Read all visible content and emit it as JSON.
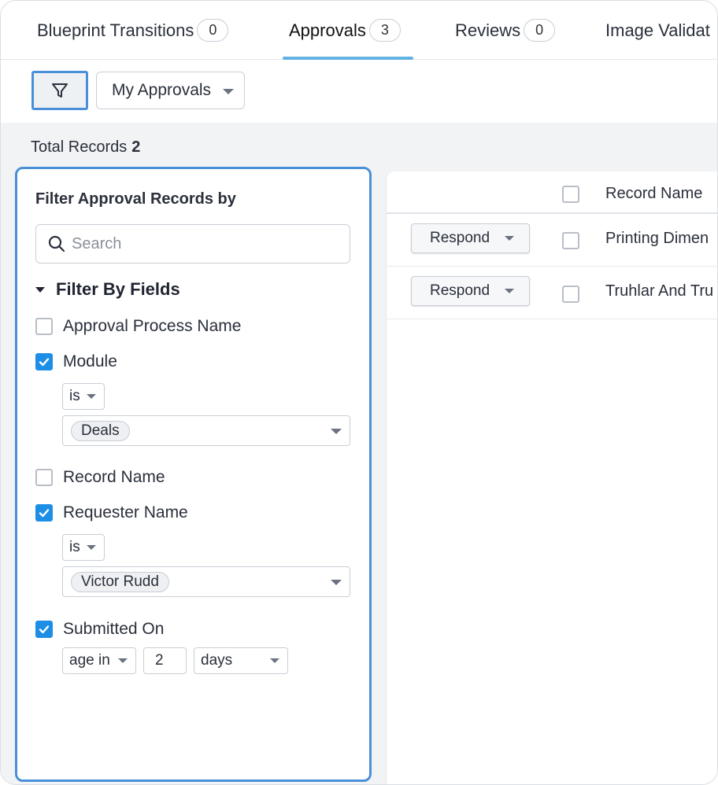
{
  "tabs": [
    {
      "label": "Blueprint Transitions",
      "count": "0"
    },
    {
      "label": "Approvals",
      "count": "3"
    },
    {
      "label": "Reviews",
      "count": "0"
    },
    {
      "label": "Image Validat",
      "count": ""
    }
  ],
  "toolbar": {
    "view_label": "My Approvals"
  },
  "summary": {
    "total_label": "Total Records",
    "total_value": "2"
  },
  "filter_panel": {
    "title": "Filter Approval Records by",
    "search_placeholder": "Search",
    "section_label": "Filter By Fields",
    "fields": {
      "approval_process": {
        "label": "Approval Process Name",
        "checked": false
      },
      "module": {
        "label": "Module",
        "checked": true,
        "operator": "is",
        "value": "Deals"
      },
      "record_name": {
        "label": "Record Name",
        "checked": false
      },
      "requester": {
        "label": "Requester Name",
        "checked": true,
        "operator": "is",
        "value": "Victor Rudd"
      },
      "submitted_on": {
        "label": "Submitted On",
        "checked": true,
        "operator": "age in",
        "amount": "2",
        "unit": "days"
      }
    }
  },
  "records": {
    "column_record_name": "Record Name",
    "respond_label": "Respond",
    "rows": [
      {
        "name": "Printing Dimen"
      },
      {
        "name": "Truhlar And Tru"
      }
    ]
  },
  "colors": {
    "accent": "#4a90d9",
    "checkbox": "#1d8ee6",
    "tab_underline": "#62b2e4"
  }
}
